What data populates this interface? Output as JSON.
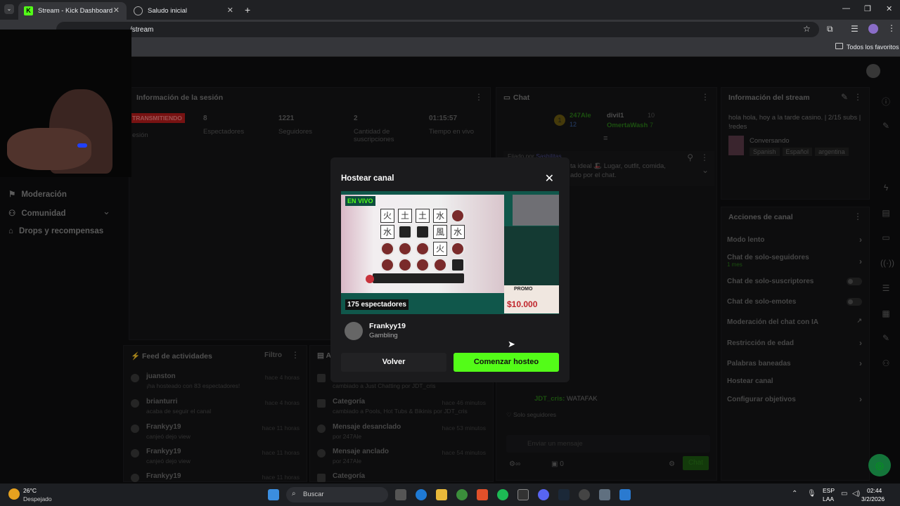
{
  "browser": {
    "tabs": [
      {
        "title": "Stream - Kick Dashboard",
        "active": true
      },
      {
        "title": "Saludo inicial",
        "active": false
      }
    ],
    "address_visible": "/stream",
    "bookmarks_label": "Todos los favoritos"
  },
  "sidebar": {
    "items": [
      {
        "label": "Moderación",
        "icon": "shield-icon"
      },
      {
        "label": "Comunidad",
        "icon": "users-icon"
      },
      {
        "label": "Drops y recompensas",
        "icon": "gift-icon"
      }
    ]
  },
  "session": {
    "title": "Información de la sesión",
    "status": "TRANSMITIENDO",
    "status_sub": "esión",
    "stats": [
      {
        "value": "8",
        "label": "Espectadores"
      },
      {
        "value": "1221",
        "label": "Seguidores"
      },
      {
        "value": "2",
        "label": "Cantidad de suscripciones"
      },
      {
        "value": "01:15:57",
        "label": "Tiempo en vivo"
      }
    ]
  },
  "chat": {
    "title": "Chat",
    "leaderboard": [
      {
        "name": "247Ale",
        "pts": "12"
      },
      {
        "name": "divil1",
        "pts": "10"
      },
      {
        "name": "OmertaWash",
        "pts": "7"
      }
    ],
    "pinned_by": "Fijado por",
    "pinned_user": "Sashilitas",
    "pinned_text": "ta ideal 🎩 Lugar, outfit, comida,",
    "pinned_text2": "ado por el chat.",
    "last_message_user": "JDT_cris:",
    "last_message_text": "WATAFAK",
    "followers_only": "Solo seguidores",
    "input_placeholder": "Enviar un mensaje",
    "send_label": "Chat",
    "counter": "0"
  },
  "stream_info": {
    "title": "Información del stream",
    "description": "hola hola, hoy a la tarde casino. | 2/15 subs | !redes",
    "category": "Conversando",
    "tags": [
      "Spanish",
      "Español",
      "argentina"
    ]
  },
  "channel_actions": {
    "title": "Acciones de canal",
    "items": [
      {
        "label": "Modo lento",
        "sub": "",
        "control": "chevron"
      },
      {
        "label": "Chat de solo-seguidores",
        "sub": "1 mes",
        "control": "chevron"
      },
      {
        "label": "Chat de solo-suscriptores",
        "sub": "",
        "control": "toggle"
      },
      {
        "label": "Chat de solo-emotes",
        "sub": "",
        "control": "toggle"
      },
      {
        "label": "Moderación del chat con IA",
        "sub": "",
        "control": "external"
      },
      {
        "label": "Restricción de edad",
        "sub": "",
        "control": "chevron"
      },
      {
        "label": "Palabras baneadas",
        "sub": "",
        "control": "chevron"
      },
      {
        "label": "Hostear canal",
        "sub": "",
        "control": "none"
      },
      {
        "label": "Configurar objetivos",
        "sub": "",
        "control": "chevron"
      }
    ]
  },
  "feed": {
    "title": "Feed de actividades",
    "filter": "Filtro",
    "rows": [
      {
        "name": "juanston",
        "sub": "¡ha hosteado con 83 espectadores!",
        "time": "hace 4 horas"
      },
      {
        "name": "brianturri",
        "sub": "acaba de seguir el canal",
        "time": "hace 4 horas"
      },
      {
        "name": "Frankyy19",
        "sub": "canjeó dejo view",
        "time": "hace 11 horas"
      },
      {
        "name": "Frankyy19",
        "sub": "canjeó dejo view",
        "time": "hace 11 horas"
      },
      {
        "name": "Frankyy19",
        "sub": "",
        "time": "hace 11 horas"
      }
    ]
  },
  "audit": {
    "title": "Ac",
    "rows": [
      {
        "name": "",
        "sub": "cambiado a Just Chatting por JDT_cris",
        "time": ""
      },
      {
        "name": "Categoría",
        "sub": "cambiado a Pools, Hot Tubs & Bikinis por JDT_cris",
        "time": "hace 46 minutos"
      },
      {
        "name": "Mensaje desanclado",
        "sub": "por 247Ale",
        "time": "hace 53 minutos"
      },
      {
        "name": "Mensaje anclado",
        "sub": "por 247Ale",
        "time": "hace 54 minutos"
      },
      {
        "name": "Categoría",
        "sub": "",
        "time": "hace 54 minutos"
      }
    ]
  },
  "modal": {
    "title": "Hostear canal",
    "live_badge": "EN VIVO",
    "viewers": "175 espectadores",
    "promo": "PROMO",
    "promo_amount": "$10.000",
    "channel_name": "Frankyy19",
    "channel_category": "Gambling",
    "back_label": "Volver",
    "start_label": "Comenzar hosteo"
  },
  "taskbar": {
    "weather_temp": "26°C",
    "weather_desc": "Despejado",
    "search_label": "Buscar",
    "lang1": "ESP",
    "lang2": "LAA",
    "time": "02:44",
    "date": "3/2/2026"
  },
  "colors": {
    "accent": "#53fc18",
    "bg": "#0e0e10"
  }
}
